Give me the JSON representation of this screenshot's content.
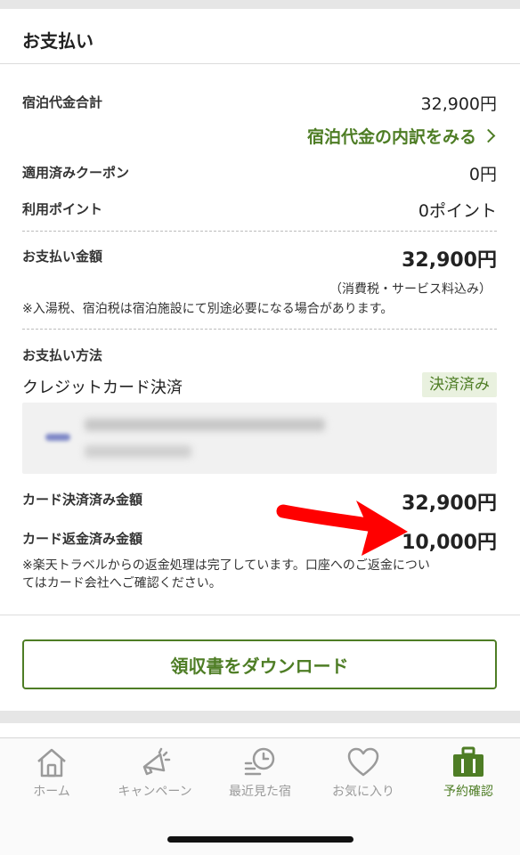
{
  "header": {
    "title": "お支払い"
  },
  "summary": {
    "lodging_total_label": "宿泊代金合計",
    "lodging_total_value": "32,900円",
    "breakdown_link": "宿泊代金の内訳をみる",
    "coupon_label": "適用済みクーポン",
    "coupon_value": "0円",
    "points_label": "利用ポイント",
    "points_value": "0ポイント",
    "payment_amount_label": "お支払い金額",
    "payment_amount_value": "32,900円",
    "tax_note": "（消費税・サービス料込み）",
    "onsen_tax_note": "※入湯税、宿泊税は宿泊施設にて別途必要になる場合があります。"
  },
  "payment_method": {
    "label": "お支払い方法",
    "method": "クレジットカード決済",
    "status_badge": "決済済み",
    "card_settled_label": "カード決済済み金額",
    "card_settled_value": "32,900円",
    "card_refund_label": "カード返金済み金額",
    "card_refund_value": "10,000円",
    "refund_note_line1": "※楽天トラベルからの返金処理は完了しています。口座へのご返金につい",
    "refund_note_line2": "てはカード会社へご確認ください。"
  },
  "receipt_button": "領収書をダウンロード",
  "tabbar": {
    "items": [
      {
        "label": "ホーム",
        "icon": "home-icon"
      },
      {
        "label": "キャンペーン",
        "icon": "megaphone-icon"
      },
      {
        "label": "最近見た宿",
        "icon": "history-clock-icon"
      },
      {
        "label": "お気に入り",
        "icon": "heart-icon"
      },
      {
        "label": "予約確認",
        "icon": "suitcase-icon"
      }
    ],
    "active_index": 4
  },
  "colors": {
    "accent_green": "#4e7d25",
    "annotation_arrow": "#ff0000",
    "inactive_tab": "#9a9a9a"
  }
}
